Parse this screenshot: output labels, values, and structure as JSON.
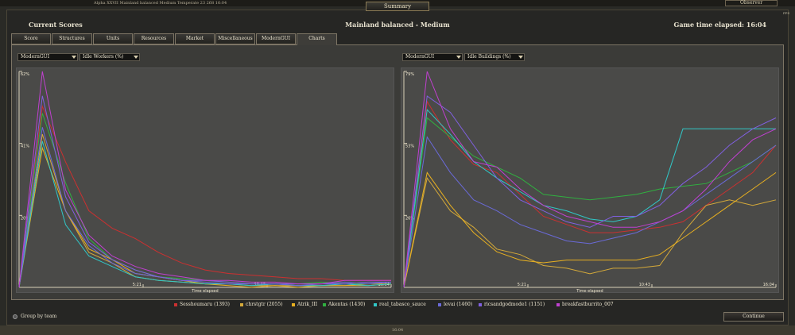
{
  "topbar": {
    "status_text": "Alpha XXVII  Mainland balanced  Medium  Temperate  23 268  16:04",
    "observer": "Observer"
  },
  "window": {
    "title": "Summary",
    "fps": "FPS"
  },
  "header": {
    "title": "Current Scores",
    "map": "Mainland balanced - Medium",
    "game_time": "Game time elapsed: 16:04"
  },
  "tabs": [
    {
      "label": "Score"
    },
    {
      "label": "Structures"
    },
    {
      "label": "Units"
    },
    {
      "label": "Resources"
    },
    {
      "label": "Market"
    },
    {
      "label": "Miscellaneous"
    },
    {
      "label": "ModernGUI"
    },
    {
      "label": "Charts"
    }
  ],
  "left_controls": {
    "category": "ModernGUI",
    "stat": "Idle Workers (%)"
  },
  "right_controls": {
    "category": "ModernGUI",
    "stat": "Idle Buildings (%)"
  },
  "legend": [
    {
      "name": "Sesshoumaru (1393)",
      "color": "#cc3030"
    },
    {
      "name": "chrstgtr (2055)",
      "color": "#d4a93a"
    },
    {
      "name": "Atrik_III",
      "color": "#e8b020"
    },
    {
      "name": "Akentas (1430)",
      "color": "#30b040"
    },
    {
      "name": "real_tabasco_sauce",
      "color": "#30c8c8"
    },
    {
      "name": "levai (1460)",
      "color": "#6a6ad8"
    },
    {
      "name": "ricsandgodmode1 (1151)",
      "color": "#8060e0"
    },
    {
      "name": "breakfastburrito_007",
      "color": "#c040d0"
    }
  ],
  "footer": {
    "group_label": "Group by team",
    "continue_label": "Continue",
    "clock": "16:04"
  },
  "chart_data": [
    {
      "type": "line",
      "title": "",
      "xlabel": "Time elapsed",
      "ylabel": "",
      "xticks": [
        "5:21",
        "10:43",
        "16:04"
      ],
      "yticks": [
        "20%",
        "41%",
        "62%"
      ],
      "ylim": [
        0,
        62
      ],
      "x": [
        0,
        1,
        2,
        3,
        4,
        5,
        6,
        7,
        8,
        9,
        10,
        11,
        12,
        13,
        14,
        15,
        16
      ],
      "series": [
        {
          "name": "Sesshoumaru (1393)",
          "values": [
            0,
            52,
            36,
            22,
            17,
            14,
            10,
            7,
            5,
            4,
            3.5,
            3,
            2.5,
            2.5,
            2,
            2,
            2
          ]
        },
        {
          "name": "chrstgtr (2055)",
          "values": [
            0,
            44,
            22,
            10,
            7,
            3,
            2,
            1.5,
            1,
            1,
            0.5,
            0.5,
            0.5,
            0.5,
            0.5,
            1,
            1
          ]
        },
        {
          "name": "Atrik_III",
          "values": [
            0,
            40,
            22,
            11,
            8,
            4,
            3,
            2,
            1,
            0.5,
            0,
            0.5,
            0,
            0.5,
            0.5,
            0.5,
            1
          ]
        },
        {
          "name": "Akentas (1430)",
          "values": [
            0,
            50,
            30,
            14,
            8,
            5,
            3,
            2.5,
            2,
            1.5,
            1,
            1,
            1,
            1.5,
            1,
            1,
            1.5
          ]
        },
        {
          "name": "real_tabasco_sauce",
          "values": [
            0,
            42,
            18,
            9,
            6,
            3,
            2,
            1.5,
            1,
            1,
            0.5,
            1,
            0.5,
            0.5,
            1,
            0.5,
            1
          ]
        },
        {
          "name": "levai (1460)",
          "values": [
            0,
            46,
            22,
            12,
            7,
            4,
            3,
            2,
            1.5,
            1,
            1,
            1,
            0.5,
            1,
            1.5,
            1,
            1.5
          ]
        },
        {
          "name": "ricsandgodmode1 (1151)",
          "values": [
            0,
            55,
            26,
            13,
            8,
            5,
            3,
            2,
            2,
            1.5,
            1,
            1,
            1,
            1,
            1,
            1.5,
            1.5
          ]
        },
        {
          "name": "breakfastburrito_007",
          "values": [
            0,
            62,
            28,
            15,
            9,
            6,
            4,
            3,
            2,
            2,
            1.5,
            1.5,
            1,
            1,
            2,
            2,
            2
          ]
        }
      ]
    },
    {
      "type": "line",
      "title": "",
      "xlabel": "Time elapsed",
      "ylabel": "",
      "xticks": [
        "5:21",
        "10:43",
        "16:04"
      ],
      "yticks": [
        "26%",
        "53%",
        "79%"
      ],
      "ylim": [
        0,
        79
      ],
      "x": [
        0,
        1,
        2,
        3,
        4,
        5,
        6,
        7,
        8,
        9,
        10,
        11,
        12,
        13,
        14,
        15,
        16
      ],
      "series": [
        {
          "name": "Sesshoumaru (1393)",
          "values": [
            0,
            68,
            54,
            45,
            42,
            34,
            26,
            23,
            20,
            20,
            21,
            22,
            24,
            30,
            36,
            42,
            52
          ]
        },
        {
          "name": "chrstgtr (2055)",
          "values": [
            0,
            40,
            28,
            22,
            14,
            12,
            8,
            7,
            5,
            7,
            7,
            8,
            20,
            30,
            32,
            30,
            32
          ]
        },
        {
          "name": "Atrik_III",
          "values": [
            0,
            42,
            30,
            20,
            13,
            10,
            9,
            10,
            10,
            10,
            10,
            12,
            18,
            24,
            30,
            36,
            42
          ]
        },
        {
          "name": "Akentas (1430)",
          "values": [
            0,
            62,
            55,
            48,
            44,
            40,
            34,
            33,
            32,
            33,
            34,
            36,
            37,
            38,
            42,
            46,
            52
          ]
        },
        {
          "name": "real_tabasco_sauce",
          "values": [
            0,
            65,
            56,
            46,
            40,
            35,
            30,
            28,
            25,
            24,
            26,
            32,
            58,
            58,
            58,
            58,
            58
          ]
        },
        {
          "name": "levai (1460)",
          "values": [
            0,
            55,
            42,
            32,
            28,
            23,
            20,
            17,
            16,
            18,
            20,
            24,
            28,
            34,
            40,
            46,
            52
          ]
        },
        {
          "name": "ricsandgodmode1 (1151)",
          "values": [
            0,
            70,
            64,
            52,
            40,
            32,
            28,
            24,
            22,
            26,
            26,
            30,
            38,
            44,
            52,
            58,
            62
          ]
        },
        {
          "name": "breakfastburrito_007",
          "values": [
            0,
            79,
            58,
            46,
            44,
            36,
            30,
            26,
            24,
            22,
            22,
            24,
            28,
            36,
            46,
            54,
            58
          ]
        }
      ]
    }
  ]
}
